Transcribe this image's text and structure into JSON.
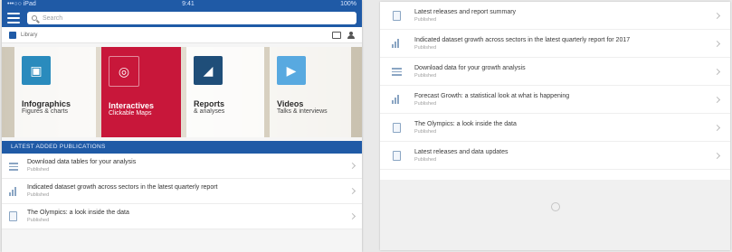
{
  "left": {
    "status": {
      "carrier": "•••○○ iPad",
      "time": "9:41",
      "battery": "100%"
    },
    "search": {
      "placeholder": "Search"
    },
    "brand": {
      "text": "Library"
    },
    "tiles": [
      {
        "title": "Infographics",
        "subtitle": "Figures & charts",
        "icon": "image-icon"
      },
      {
        "title": "Interactives",
        "subtitle": "Clickable Maps",
        "icon": "globe-icon"
      },
      {
        "title": "Reports",
        "subtitle": "& analyses",
        "icon": "chart-icon"
      },
      {
        "title": "Videos",
        "subtitle": "Talks & interviews",
        "icon": "video-icon"
      }
    ],
    "section_title": "LATEST ADDED PUBLICATIONS",
    "items": [
      {
        "type": "table",
        "title": "Download data tables for your analysis",
        "date": "Published"
      },
      {
        "type": "chart",
        "title": "Indicated dataset growth across sectors in the latest quarterly report",
        "date": "Published"
      },
      {
        "type": "doc",
        "title": "The Olympics: a look inside the data",
        "date": "Published"
      }
    ]
  },
  "right": {
    "items": [
      {
        "type": "doc",
        "title": "Latest releases and report summary",
        "date": "Published"
      },
      {
        "type": "chart",
        "title": "Indicated dataset growth across sectors in the latest quarterly report for 2017",
        "date": "Published"
      },
      {
        "type": "table",
        "title": "Download data for your growth analysis",
        "date": "Published"
      },
      {
        "type": "chart",
        "title": "Forecast Growth: a statistical look at what is happening",
        "date": "Published"
      },
      {
        "type": "doc",
        "title": "The Olympics: a look inside the data",
        "date": "Published"
      },
      {
        "type": "doc",
        "title": "Latest releases and data updates",
        "date": "Published"
      }
    ]
  }
}
